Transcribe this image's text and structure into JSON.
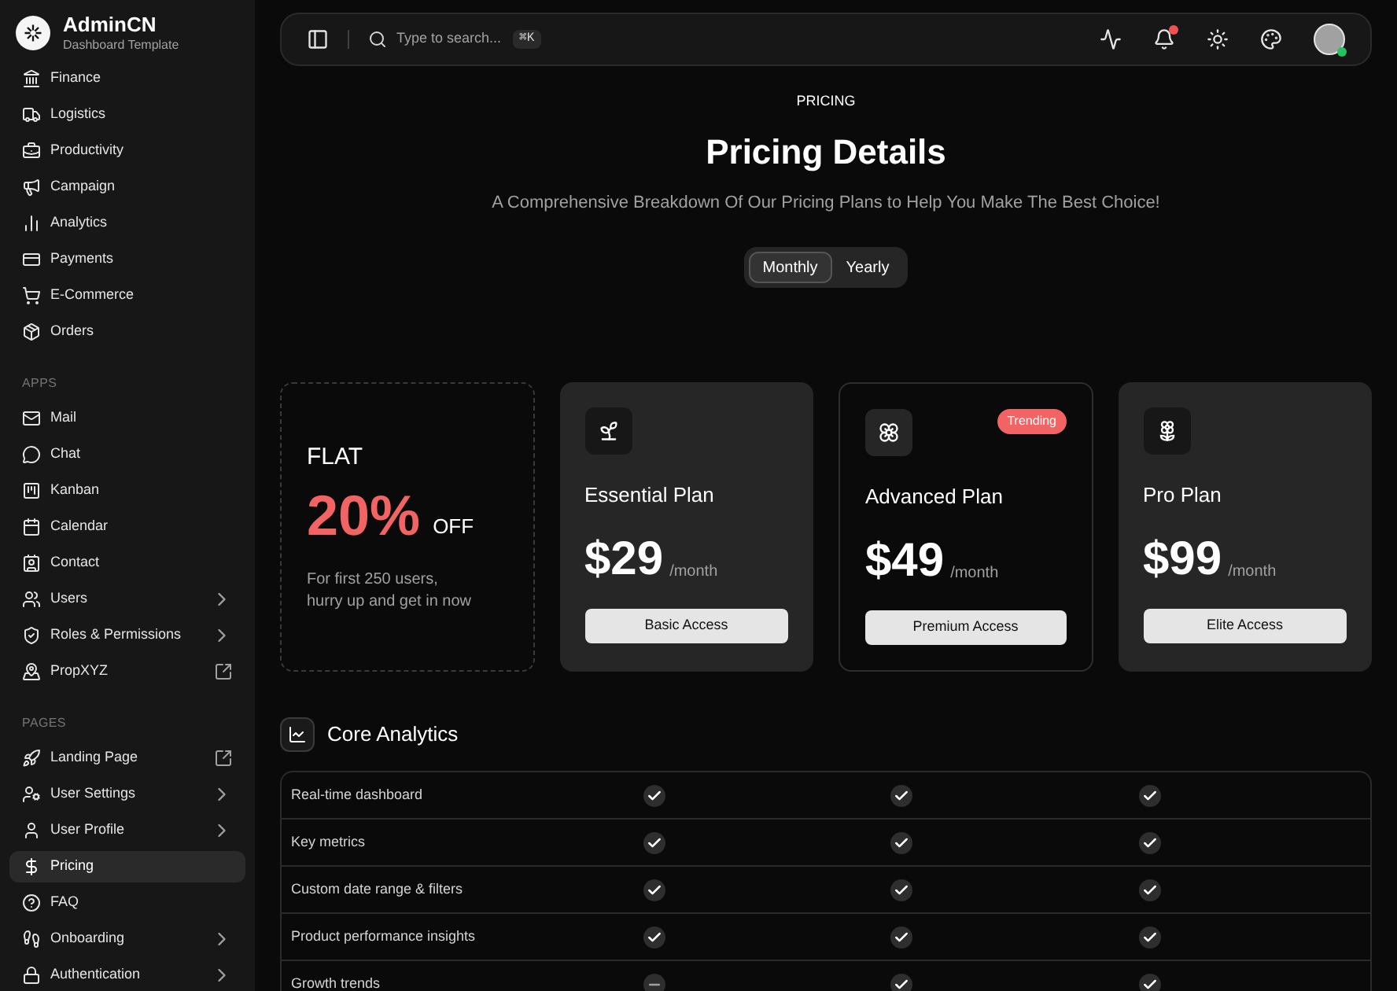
{
  "brand": {
    "name": "AdminCN",
    "subtitle": "Dashboard Template"
  },
  "sidebar": {
    "sections": [
      {
        "items": [
          {
            "label": "Finance",
            "selected": false
          },
          {
            "label": "Logistics",
            "selected": false
          },
          {
            "label": "Productivity",
            "selected": false
          },
          {
            "label": "Campaign",
            "selected": false
          },
          {
            "label": "Analytics",
            "selected": false
          },
          {
            "label": "Payments",
            "selected": false
          },
          {
            "label": "E-Commerce",
            "selected": false
          },
          {
            "label": "Orders",
            "selected": false
          }
        ]
      },
      {
        "title": "APPS",
        "items": [
          {
            "label": "Mail",
            "selected": false
          },
          {
            "label": "Chat",
            "selected": false
          },
          {
            "label": "Kanban",
            "selected": false
          },
          {
            "label": "Calendar",
            "selected": false
          },
          {
            "label": "Contact",
            "selected": false
          },
          {
            "label": "Users",
            "selected": false,
            "submenu": true
          },
          {
            "label": "Roles & Permissions",
            "selected": false,
            "submenu": true
          },
          {
            "label": "PropXYZ",
            "selected": false,
            "external": true
          }
        ]
      },
      {
        "title": "PAGES",
        "items": [
          {
            "label": "Landing Page",
            "selected": false,
            "external": true
          },
          {
            "label": "User Settings",
            "selected": false,
            "submenu": true
          },
          {
            "label": "User Profile",
            "selected": false,
            "submenu": true
          },
          {
            "label": "Pricing",
            "selected": true
          },
          {
            "label": "FAQ",
            "selected": false
          },
          {
            "label": "Onboarding",
            "selected": false,
            "submenu": true
          },
          {
            "label": "Authentication",
            "selected": false,
            "submenu": true
          }
        ]
      }
    ]
  },
  "topbar": {
    "search": {
      "placeholder": "Type to search...",
      "shortcut": "⌘K"
    },
    "notifications_unread": true,
    "user_online": true
  },
  "header": {
    "eyebrow": "PRICING",
    "title": "Pricing Details",
    "subtitle": "A Comprehensive Breakdown Of Our Pricing Plans to Help You Make The Best Choice!"
  },
  "billing_toggle": [
    {
      "label": "Monthly",
      "selected": true
    },
    {
      "label": "Yearly",
      "selected": false
    }
  ],
  "cards": [
    {
      "kind": "promo",
      "eyebrow": "FLAT",
      "amount": "20%",
      "suffix": "OFF",
      "note": "For first 250 users,\nhurry up and get in now"
    },
    {
      "kind": "plan",
      "name": "Essential Plan",
      "price": "$29",
      "period": "/month",
      "button": "Basic Access",
      "featured": false
    },
    {
      "kind": "plan",
      "name": "Advanced Plan",
      "price": "$49",
      "period": "/month",
      "button": "Premium Access",
      "featured": true,
      "badge": "Trending"
    },
    {
      "kind": "plan",
      "name": "Pro Plan",
      "price": "$99",
      "period": "/month",
      "button": "Elite Access",
      "featured": false
    }
  ],
  "features": {
    "title": "Core Analytics",
    "rows": [
      {
        "name": "Real-time dashboard",
        "included": [
          true,
          true,
          true
        ]
      },
      {
        "name": "Key metrics",
        "included": [
          true,
          true,
          true
        ]
      },
      {
        "name": "Custom date range & filters",
        "included": [
          true,
          true,
          true
        ]
      },
      {
        "name": "Product performance insights",
        "included": [
          true,
          true,
          true
        ]
      },
      {
        "name": "Growth trends",
        "included": [
          false,
          true,
          true
        ]
      }
    ]
  }
}
